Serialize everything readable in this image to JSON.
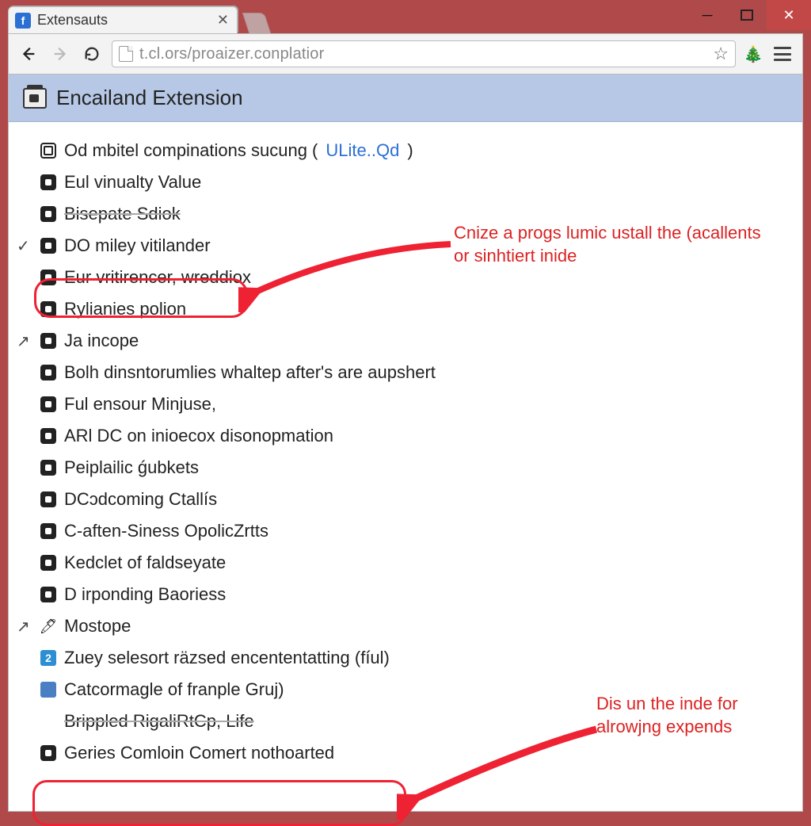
{
  "tab": {
    "title": "Extensauts"
  },
  "url": "t.cl.ors/proaizer.conplatior",
  "header": {
    "title": "Encailand Extension"
  },
  "items": [
    {
      "mark": "",
      "icon": "outline",
      "label": "Od mbitel compinations sucung (",
      "link": "ULite..Qd",
      "tail": ")"
    },
    {
      "mark": "",
      "icon": "filled",
      "label": "Eul vinualty Value"
    },
    {
      "mark": "",
      "icon": "filled",
      "label": "Bisepate Sdiok",
      "struck": true
    },
    {
      "mark": "✓",
      "icon": "filled",
      "label": "DO miley vitilander"
    },
    {
      "mark": "",
      "icon": "filled",
      "label": "Eur vritirencer, wreddiox"
    },
    {
      "mark": "",
      "icon": "filled",
      "label": "Rylianies polion"
    },
    {
      "mark": "↗",
      "icon": "filled",
      "label": "Ja incope"
    },
    {
      "mark": "",
      "icon": "filled",
      "label": "Bolh dinsntorumlies whaltep after's are aupshert"
    },
    {
      "mark": "",
      "icon": "filled",
      "label": "Ful ensour Minjuse,"
    },
    {
      "mark": "",
      "icon": "filled",
      "label": "ARl DC on inioecox disonopmation"
    },
    {
      "mark": "",
      "icon": "filled",
      "label": "Peiplailic ǵubkets"
    },
    {
      "mark": "",
      "icon": "filled",
      "label": "DCɔdcoming Ctallís"
    },
    {
      "mark": "",
      "icon": "filled",
      "label": "C-aften-Siness OpolicZrtts"
    },
    {
      "mark": "",
      "icon": "filled",
      "label": "Kedclet of faldseyate"
    },
    {
      "mark": "",
      "icon": "filled",
      "label": "D irponding Baoriess"
    },
    {
      "mark": "↗",
      "icon": "wand",
      "label": "Mostope"
    },
    {
      "mark": "",
      "icon": "blue",
      "label": "Zuey selesort räzsed encententatting (fíul)"
    },
    {
      "mark": "",
      "icon": "blue2",
      "label": "Catcormagle of franple Gruj)"
    },
    {
      "mark": "",
      "icon": "blank",
      "label": "Brippled RigaliRtCp, Life",
      "struck": true
    },
    {
      "mark": "",
      "icon": "filled",
      "label": "Geries Comloin Comert nothoarted"
    }
  ],
  "annotations": {
    "a1": "Cnize a progs lumic ustall the (acallents or sinhtiert inide",
    "a2": "Dis un the inde for alrowjng expends"
  }
}
